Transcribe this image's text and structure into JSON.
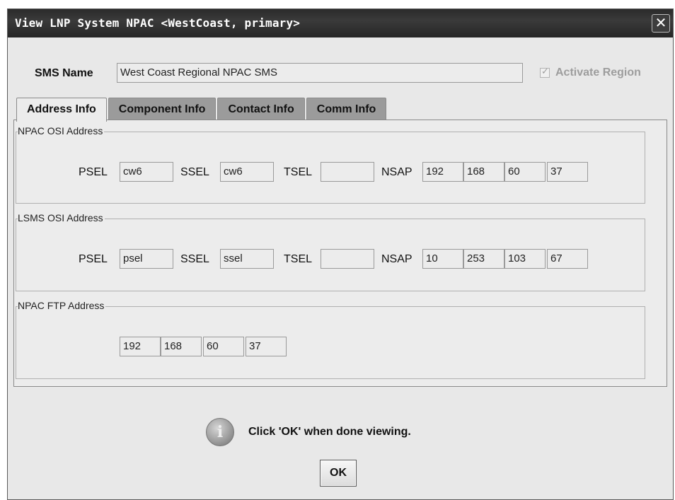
{
  "window": {
    "title": "View LNP System NPAC <WestCoast, primary>"
  },
  "sms": {
    "label": "SMS Name",
    "value": "West Coast Regional NPAC SMS"
  },
  "activate_region": {
    "label": "Activate Region",
    "checked": true,
    "enabled": false
  },
  "tabs": [
    {
      "label": "Address Info",
      "active": true
    },
    {
      "label": "Component Info",
      "active": false
    },
    {
      "label": "Contact Info",
      "active": false
    },
    {
      "label": "Comm Info",
      "active": false
    }
  ],
  "npac_osi": {
    "title": "NPAC OSI Address",
    "psel_label": "PSEL",
    "psel": "cw6",
    "ssel_label": "SSEL",
    "ssel": "cw6",
    "tsel_label": "TSEL",
    "tsel": "",
    "nsap_label": "NSAP",
    "nsap": [
      "192",
      "168",
      "60",
      "37"
    ]
  },
  "lsms_osi": {
    "title": "LSMS OSI Address",
    "psel_label": "PSEL",
    "psel": "psel",
    "ssel_label": "SSEL",
    "ssel": "ssel",
    "tsel_label": "TSEL",
    "tsel": "",
    "nsap_label": "NSAP",
    "nsap": [
      "10",
      "253",
      "103",
      "67"
    ]
  },
  "npac_ftp": {
    "title": "NPAC FTP Address",
    "ip": [
      "192",
      "168",
      "60",
      "37"
    ]
  },
  "footer": {
    "info_icon": "info-icon",
    "message": "Click 'OK' when done viewing.",
    "ok_label": "OK"
  }
}
